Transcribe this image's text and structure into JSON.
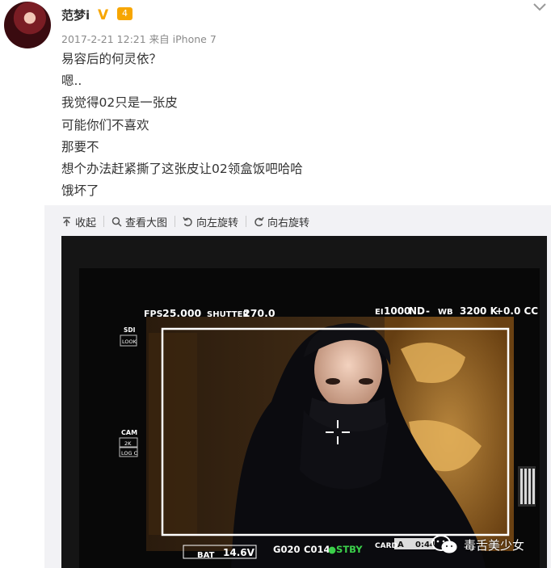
{
  "post": {
    "username": "范梦i",
    "verified_mark": "V",
    "level_badge": "4",
    "date": "2017-2-21 12:21",
    "source_prefix": "来自",
    "source_device": "iPhone 7",
    "lines": [
      "易容后的何灵依？",
      "嗯..",
      "我觉得02只是一张皮",
      "可能你们不喜欢",
      "那要不",
      "想个办法赶紧撕了这张皮让02领盒饭吧哈哈",
      "饿坏了"
    ]
  },
  "toolbar": {
    "collapse": "收起",
    "view_large": "查看大图",
    "rotate_left": "向左旋转",
    "rotate_right": "向右旋转"
  },
  "monitor": {
    "fps_label": "FPS",
    "fps_value": "25.000",
    "shutter_label": "SHUTTER",
    "shutter_value": "270.0",
    "ei_label": "EI",
    "ei_value": "1000",
    "nd_label": "ND",
    "nd_value": "-",
    "wb_label": "WB",
    "wb_value": "3200 K",
    "cc_value": "+0.0 CC",
    "sdi_label": "SDI",
    "sdi_value": "LOOK",
    "cam_label": "CAM",
    "cam_res": "2K",
    "cam_mode": "LOG C",
    "bat_label": "BAT",
    "bat_value": "14.6V",
    "reel": "G020",
    "clip": "C014",
    "stby": "●STBY",
    "card_label": "CARD",
    "card_slot": "A",
    "card_time": "0:44"
  },
  "watermark": {
    "text": "毒舌美少女"
  },
  "colors": {
    "verified": "#f7a600",
    "toolbar_bg": "#f2f2f5",
    "stby_green": "#3bd04a"
  }
}
